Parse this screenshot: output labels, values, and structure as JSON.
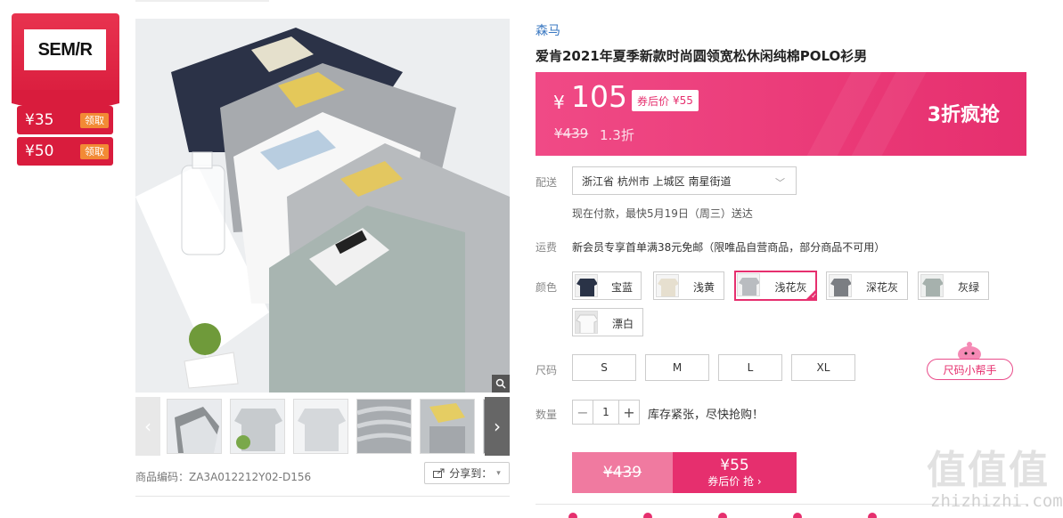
{
  "brand_panel": {
    "logo_text": "SEM/R",
    "coupons": [
      {
        "amount": "¥35",
        "action": "领取"
      },
      {
        "amount": "¥50",
        "action": "领取"
      }
    ]
  },
  "gallery": {
    "product_code": "商品编码：ZA3A012212Y02-D156",
    "share_label": "分享到：",
    "thumbnails": [
      "thumb-1",
      "thumb-2",
      "thumb-3",
      "thumb-4",
      "thumb-5",
      "thumb-6"
    ]
  },
  "product": {
    "brand": "森马",
    "title": "爱肯2021年夏季新款时尚圆领宽松休闲纯棉POLO衫男"
  },
  "price": {
    "currency": "¥",
    "current": "105",
    "after_coupon_label": "券后价",
    "after_coupon_value": "¥55",
    "original": "¥439",
    "discount": "1.3折",
    "promo": "3折疯抢"
  },
  "shipping": {
    "label": "配送",
    "location": "浙江省 杭州市 上城区 南星街道",
    "delivery_note": "现在付款，最快5月19日（周三）送达"
  },
  "freight": {
    "label": "运费",
    "text": "新会员专享首单满38元免邮（限唯品自营商品，部分商品不可用）"
  },
  "colors": {
    "label": "颜色",
    "options": [
      {
        "name": "宝蓝",
        "swatch": "#2a3347",
        "selected": false
      },
      {
        "name": "浅黄",
        "swatch": "#e6dfcf",
        "selected": false
      },
      {
        "name": "浅花灰",
        "swatch": "#b9bcc0",
        "selected": true
      },
      {
        "name": "深花灰",
        "swatch": "#7b7e83",
        "selected": false
      },
      {
        "name": "灰绿",
        "swatch": "#a6b1ad",
        "selected": false
      },
      {
        "name": "漂白",
        "swatch": "#f4f4f4",
        "selected": false
      }
    ]
  },
  "sizes": {
    "label": "尺码",
    "options": [
      "S",
      "M",
      "L",
      "XL"
    ],
    "helper": "尺码小帮手"
  },
  "quantity": {
    "label": "数量",
    "value": "1",
    "minus": "−",
    "plus": "+",
    "stock_note": "库存紧张，尽快抢购！"
  },
  "buy": {
    "original": "¥439",
    "coupon_price": "¥55",
    "coupon_action": "券后价 抢 ›"
  },
  "watermark": {
    "chars": "值值值",
    "url": "zhizhizhi.com"
  },
  "colors_theme": {
    "accent": "#e62f6e",
    "brand_red": "#d91c3d",
    "link_blue": "#3a78c2"
  }
}
